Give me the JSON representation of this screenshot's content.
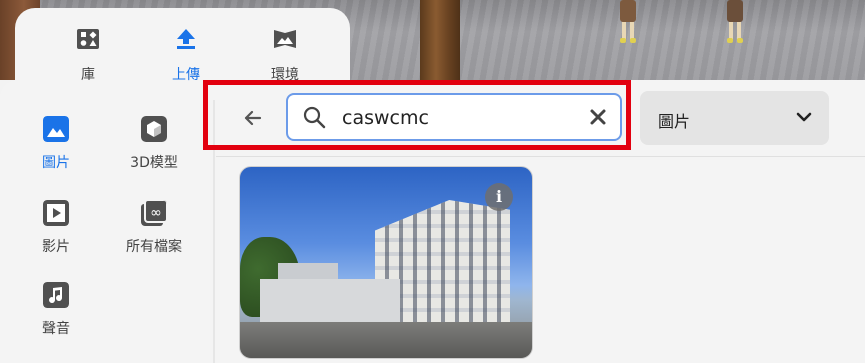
{
  "tabs": [
    {
      "label": "庫",
      "icon": "library-icon"
    },
    {
      "label": "上傳",
      "icon": "upload-icon"
    },
    {
      "label": "環境",
      "icon": "environment-icon"
    }
  ],
  "sidebar": {
    "items": [
      {
        "label": "圖片",
        "icon": "image-icon"
      },
      {
        "label": "3D模型",
        "icon": "cube-icon"
      },
      {
        "label": "影片",
        "icon": "video-icon"
      },
      {
        "label": "所有檔案",
        "icon": "all-files-icon"
      },
      {
        "label": "聲音",
        "icon": "music-icon"
      }
    ]
  },
  "search": {
    "value": "caswcmc",
    "back_icon": "back-arrow-icon",
    "clear_icon": "clear-icon"
  },
  "filter": {
    "selected": "圖片",
    "icon": "chevron-down-icon"
  },
  "results": [
    {
      "type": "image",
      "info_glyph": "i"
    }
  ],
  "colors": {
    "accent": "#1a73e8",
    "highlight": "#e2000f",
    "search_border": "#6c9be9"
  }
}
